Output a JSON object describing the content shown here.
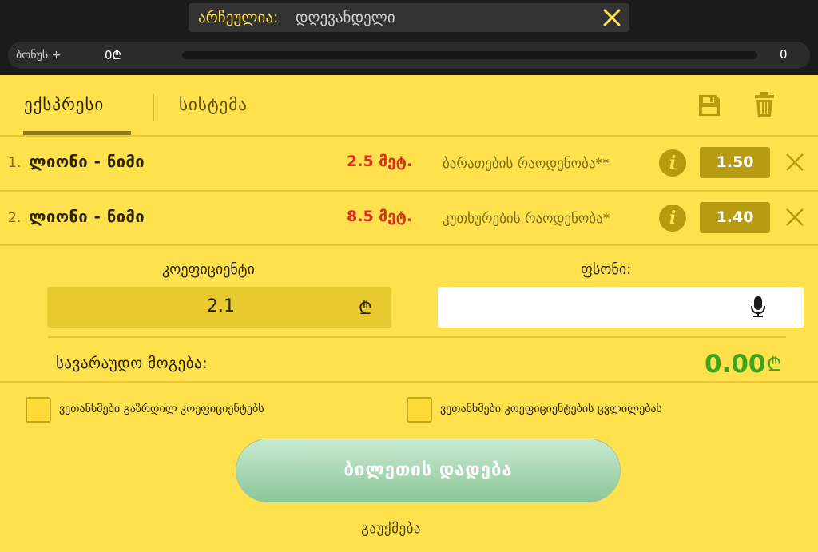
{
  "header": {
    "selected_label": "არჩეულია:",
    "selected_value": "დღევანდელი",
    "close_icon": "close-icon"
  },
  "bonus": {
    "label": "ბონუს +",
    "amount": "0₾",
    "progress": 0,
    "count": "0"
  },
  "tabs": [
    {
      "label": "ექსპრესი",
      "active": true
    },
    {
      "label": "სისტემა",
      "active": false
    }
  ],
  "toolbar": {
    "save_icon": "save-icon",
    "trash_icon": "trash-icon"
  },
  "bets": [
    {
      "index": "1.",
      "event": "ლიონი - ნიმი",
      "selection": "2.5 მეტ.",
      "market": "ბარათების რაოდენობა**",
      "odd": "1.50"
    },
    {
      "index": "2.",
      "event": "ლიონი - ნიმი",
      "selection": "8.5 მეტ.",
      "market": "კუთხურების რაოდენობა*",
      "odd": "1.40"
    }
  ],
  "coefficient": {
    "label": "კოეფიციენტი",
    "value": "2.1",
    "currency": "₾"
  },
  "stake": {
    "label": "ფსონი:",
    "placeholder": "",
    "icon": "mic-icon"
  },
  "possible_win": {
    "label": "სავარაუდო მოგება:",
    "amount": "0.00",
    "currency": "₾"
  },
  "options": [
    {
      "label": "ვეთანხმები გაზრდილ კოეფიციენტებს",
      "checked": false
    },
    {
      "label": "ვეთანხმები კოეფიციენტების ცვლილებას",
      "checked": false
    }
  ],
  "actions": {
    "place_bet": "ბილეთის დადება",
    "cancel": "გაუქმება"
  },
  "colors": {
    "background": "#ffe14d",
    "odds_box": "#b79b12",
    "selection_red": "#e02a1a",
    "win_green": "#3ba51c",
    "topbar": "#1b1b1b"
  }
}
